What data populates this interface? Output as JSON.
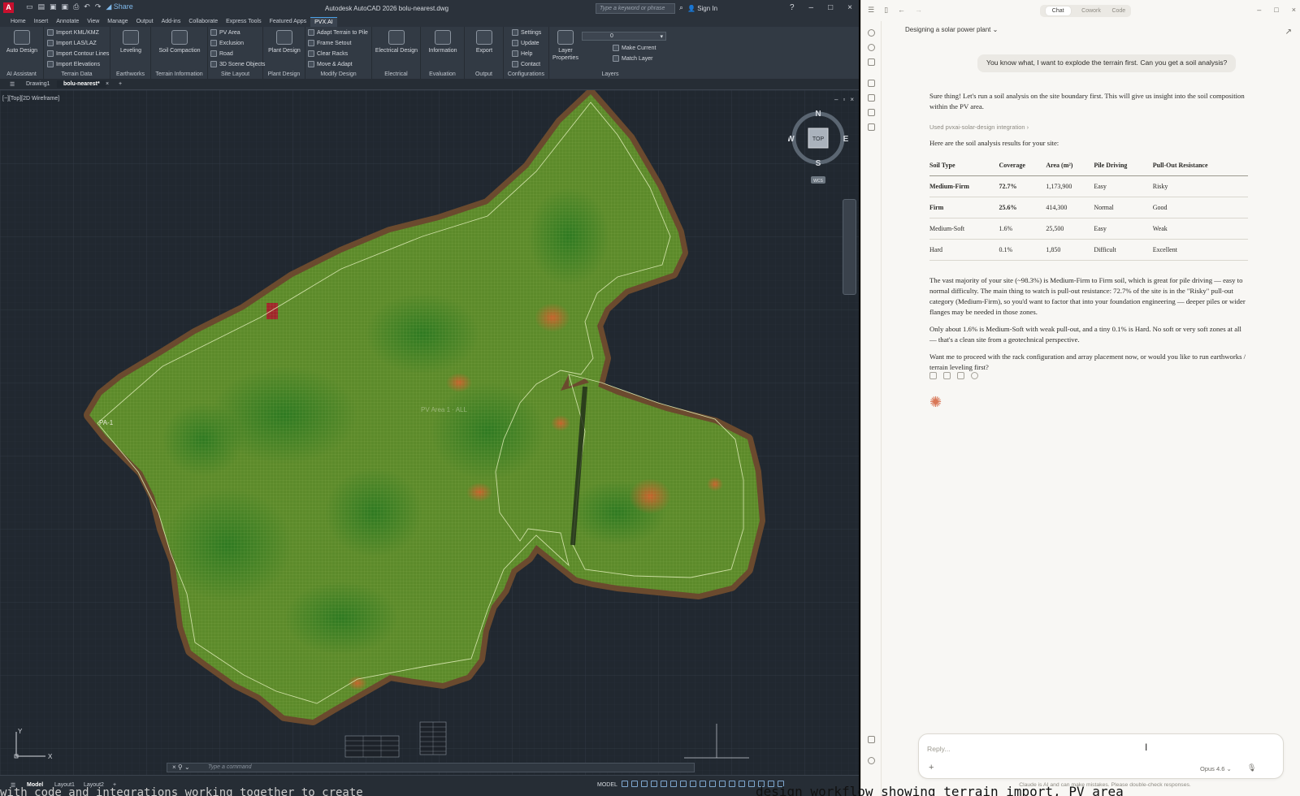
{
  "acad": {
    "quick_share": "Share",
    "title": "Autodesk AutoCAD 2026   bolu-nearest.dwg",
    "search_placeholder": "Type a keyword or phrase",
    "sign_in": "Sign In",
    "menu": [
      "Home",
      "Insert",
      "Annotate",
      "View",
      "Manage",
      "Output",
      "Add-ins",
      "Collaborate",
      "Express Tools",
      "Featured Apps",
      "PVX.AI"
    ],
    "ribbon": {
      "auto_design": "Auto Design",
      "panel_ai": "AI Assistant",
      "import_kml": "Import KML/KMZ",
      "import_las": "Import LAS/LAZ",
      "import_contour": "Import Contour Lines",
      "import_elev": "Import Elevations",
      "panel_terrain_data": "Terrain Data",
      "leveling": "Leveling",
      "panel_earthworks": "Earthworks",
      "soil_compaction": "Soil Compaction",
      "panel_terrain_info": "Terrain Information",
      "pv_area": "PV Area",
      "exclusion": "Exclusion",
      "road": "Road",
      "scene_objects": "3D Scene Objects",
      "panel_site_layout": "Site Layout",
      "plant_design": "Plant Design",
      "panel_plant_design": "Plant Design",
      "adapt_terrain": "Adapt Terrain to Pile",
      "frame_setout": "Frame Setout",
      "clear_racks": "Clear Racks",
      "move_adapt": "Move & Adapt",
      "panel_modify": "Modify Design",
      "electrical_design": "Electrical Design",
      "panel_electrical": "Electrical",
      "information": "Information",
      "panel_evaluation": "Evaluation",
      "export": "Export",
      "panel_output": "Output",
      "settings": "Settings",
      "update": "Update",
      "help": "Help",
      "contact": "Contact",
      "panel_config": "Configurations",
      "layer_properties": "Layer Properties",
      "layer_current": "0",
      "make_current": "Make Current",
      "match_layer": "Match Layer",
      "panel_layers": "Layers"
    },
    "doc_tabs": [
      "Drawing1",
      "bolu-nearest*"
    ],
    "viewport_label": "[−][Top][2D Wireframe]",
    "viewcube": {
      "n": "N",
      "s": "S",
      "e": "E",
      "w": "W",
      "top": "TOP",
      "wcs": "WCS"
    },
    "area_label": "PA-1",
    "pv_label": "PV Area 1 · ALL",
    "ucs": {
      "x": "X",
      "y": "Y"
    },
    "command_placeholder": "Type a command",
    "layout_tabs": [
      "Model",
      "Layout1",
      "Layout2"
    ],
    "model_label": "MODEL"
  },
  "claude": {
    "tabs": [
      "Chat",
      "Cowork",
      "Code"
    ],
    "conversation_title": "Designing a solar power plant",
    "user_message": "You know what, I want to explode the terrain first. Can you get a soil analysis?",
    "intro": "Sure thing! Let's run a soil analysis on the site boundary first. This will give us insight into the soil composition within the PV area.",
    "tool_used": "Used pvxai-solar-design integration  ›",
    "results_heading": "Here are the soil analysis results for your site:",
    "table": {
      "headers": [
        "Soil Type",
        "Coverage",
        "Area (m²)",
        "Pile Driving",
        "Pull-Out Resistance"
      ],
      "rows": [
        [
          "Medium-Firm",
          "72.7%",
          "1,173,900",
          "Easy",
          "Risky"
        ],
        [
          "Firm",
          "25.6%",
          "414,300",
          "Normal",
          "Good"
        ],
        [
          "Medium-Soft",
          "1.6%",
          "25,500",
          "Easy",
          "Weak"
        ],
        [
          "Hard",
          "0.1%",
          "1,850",
          "Difficult",
          "Excellent"
        ]
      ]
    },
    "para1": "The vast majority of your site (~98.3%) is Medium-Firm to Firm soil, which is great for pile driving — easy to normal difficulty. The main thing to watch is pull-out resistance: 72.7% of the site is in the \"Risky\" pull-out category (Medium-Firm), so you'd want to factor that into your foundation engineering — deeper piles or wider flanges may be needed in those zones.",
    "para2": "Only about 1.6% is Medium-Soft with weak pull-out, and a tiny 0.1% is Hard. No soft or very soft zones at all — that's a clean site from a geotechnical perspective.",
    "para3": "Want me to proceed with the rack configuration and array placement now, or would you like to run earthworks / terrain leveling first?",
    "reply_placeholder": "Reply...",
    "model": "Opus 4.6 ⌄",
    "disclaimer": "Claude is AI and can make mistakes. Please double-check responses."
  },
  "overlay_caption_right": "design workflow showing terrain import, PV area",
  "overlay_caption_left": "with code and integrations working together to create",
  "colors": {
    "accent": "#4aa0e6",
    "claude_orange": "#d97757",
    "terrain_green": "#5c8a2a"
  }
}
